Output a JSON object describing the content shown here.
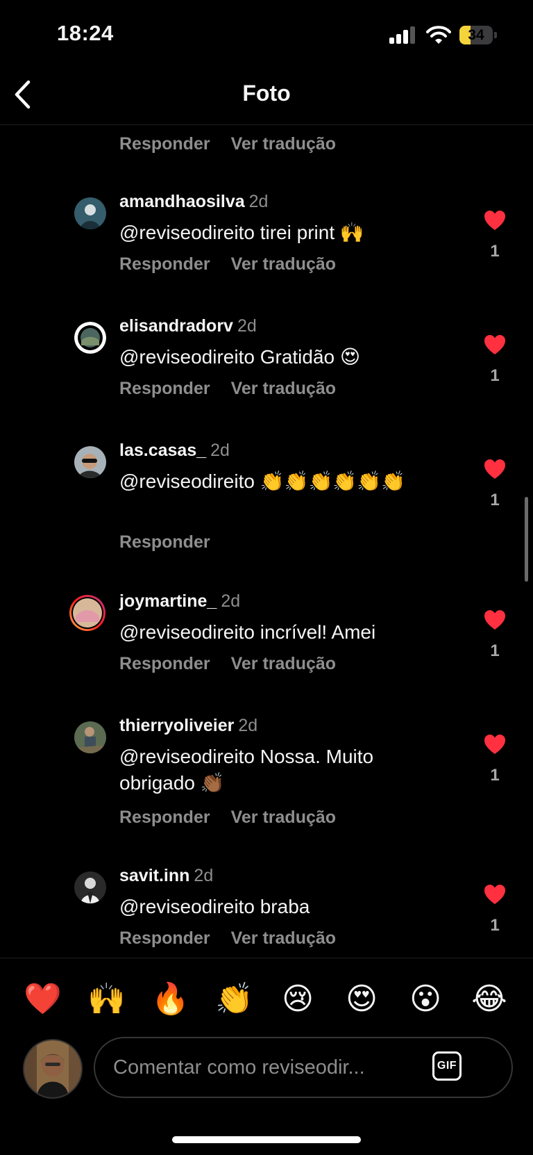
{
  "status_bar": {
    "time": "18:24",
    "battery_level": "34",
    "battery_percent": 34,
    "signal_bars": 3,
    "battery_color": "#f4d33b"
  },
  "nav": {
    "title": "Foto",
    "back_icon": "chevron-left-icon"
  },
  "top_actions": {
    "reply": "Responder",
    "translate": "Ver tradução"
  },
  "comments": [
    {
      "username": "amandhaosilva",
      "time": "2d",
      "text": "@reviseodireito tirei print 🙌",
      "reply": "Responder",
      "translate": "Ver tradução",
      "likes": "1",
      "liked": true
    },
    {
      "username": "elisandradorv",
      "time": "2d",
      "text": "@reviseodireito Gratidão 😍",
      "reply": "Responder",
      "translate": "Ver tradução",
      "likes": "1",
      "liked": true
    },
    {
      "username": "las.casas_",
      "time": "2d",
      "text": "@reviseodireito 👏👏👏👏👏👏",
      "reply": "Responder",
      "translate": "",
      "likes": "1",
      "liked": true
    },
    {
      "username": "joymartine_",
      "time": "2d",
      "text": "@reviseodireito incrível! Amei",
      "reply": "Responder",
      "translate": "Ver tradução",
      "likes": "1",
      "liked": true
    },
    {
      "username": "thierryoliveier",
      "time": "2d",
      "text": "@reviseodireito Nossa. Muito obrigado 👏🏾",
      "reply": "Responder",
      "translate": "Ver tradução",
      "likes": "1",
      "liked": true
    },
    {
      "username": "savit.inn",
      "time": "2d",
      "text": "@reviseodireito braba",
      "reply": "Responder",
      "translate": "Ver tradução",
      "likes": "1",
      "liked": true
    }
  ],
  "reactions": [
    "❤️",
    "🙌",
    "🔥",
    "👏",
    "😢",
    "😍",
    "😮",
    "😂"
  ],
  "composer": {
    "placeholder": "Comentar como reviseodir...",
    "gif_label": "GIF"
  },
  "colors": {
    "background": "#000000",
    "text": "#f5f5f5",
    "secondary": "#8e8e8e",
    "like": "#ff3040"
  }
}
